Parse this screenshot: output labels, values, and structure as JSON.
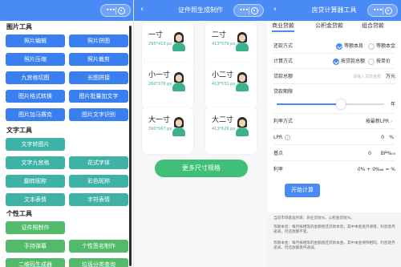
{
  "colors": {
    "primary_blue": "#4a8af4",
    "button_blue": "#3a7ff0",
    "teal": "#3fb2a6",
    "green": "#52ba6a",
    "more_green": "#3fbf77"
  },
  "panel1": {
    "sections": [
      {
        "title": "图片工具",
        "buttons": [
          "照片编辑",
          "照片拼图",
          "照片压缩",
          "照片裁剪",
          "九宫格切图",
          "长图拼接",
          "图片格式转换",
          "图片批量加文字",
          "图片加马赛克",
          "图片文字识别"
        ]
      },
      {
        "title": "文字工具",
        "buttons": [
          "文字转图片",
          "文字九宫格",
          "花式字体",
          "翻转昵称",
          "彩色昵称",
          "文本表情",
          "字符表情"
        ]
      },
      {
        "title": "个性工具",
        "buttons": [
          "证件照制作",
          "手持弹幕",
          "个性签名制作",
          "二维码生成器",
          "垃圾分类查询"
        ]
      }
    ]
  },
  "panel2": {
    "header": {
      "title": "证件照生成制作",
      "back": "‹"
    },
    "cards": [
      {
        "size": "一寸",
        "px": "295*413 px"
      },
      {
        "size": "二寸",
        "px": "413*579 px"
      },
      {
        "size": "小一寸",
        "px": "260*378 px"
      },
      {
        "size": "小二寸",
        "px": "413*531 px"
      },
      {
        "size": "大一寸",
        "px": "390*567 px"
      },
      {
        "size": "大二寸",
        "px": "413*626 px"
      }
    ],
    "more_button": "更多尺寸规格"
  },
  "panel3": {
    "header": {
      "title": "房贷计算器工具",
      "back": "‹"
    },
    "tabs": [
      "商业贷款",
      "公积金贷款",
      "组合贷款"
    ],
    "active_tab_index": 0,
    "repay_method": {
      "label": "还款方式",
      "options": [
        "等额本息",
        "等额本金"
      ],
      "selected_index": 0
    },
    "calc_method": {
      "label": "计算方式",
      "options": [
        "按贷款总额",
        "按单价"
      ],
      "selected_index": 0
    },
    "loan_total": {
      "label": "贷款总额",
      "placeholder": "请输入贷款金额",
      "unit": "万元"
    },
    "loan_term": {
      "label": "贷款期限",
      "slider_fraction": 0.6,
      "unit": "年"
    },
    "rate_method": {
      "label": "利率方式",
      "value": "按最新LPR"
    },
    "lpr": {
      "label": "LPR",
      "value": "0",
      "unit": "%"
    },
    "basis": {
      "label": "基点",
      "value": "0",
      "unit": "BP%₀₀"
    },
    "rate": {
      "label": "利率",
      "value": "0% + 0‱ = %"
    },
    "calc_button": "开始计算",
    "notes": [
      "当前市场基准利率：商业贷款%，公积金贷款%。",
      "等额本息：每月按相等的金额偿还贷款本息，其中本金逐月递增，利息逐月递减，月还款额不变。",
      "等额本金：每月按相等的金额偿还贷款本金，其中本金保持相同，利息逐月递减，月还款额逐月递减。"
    ]
  }
}
